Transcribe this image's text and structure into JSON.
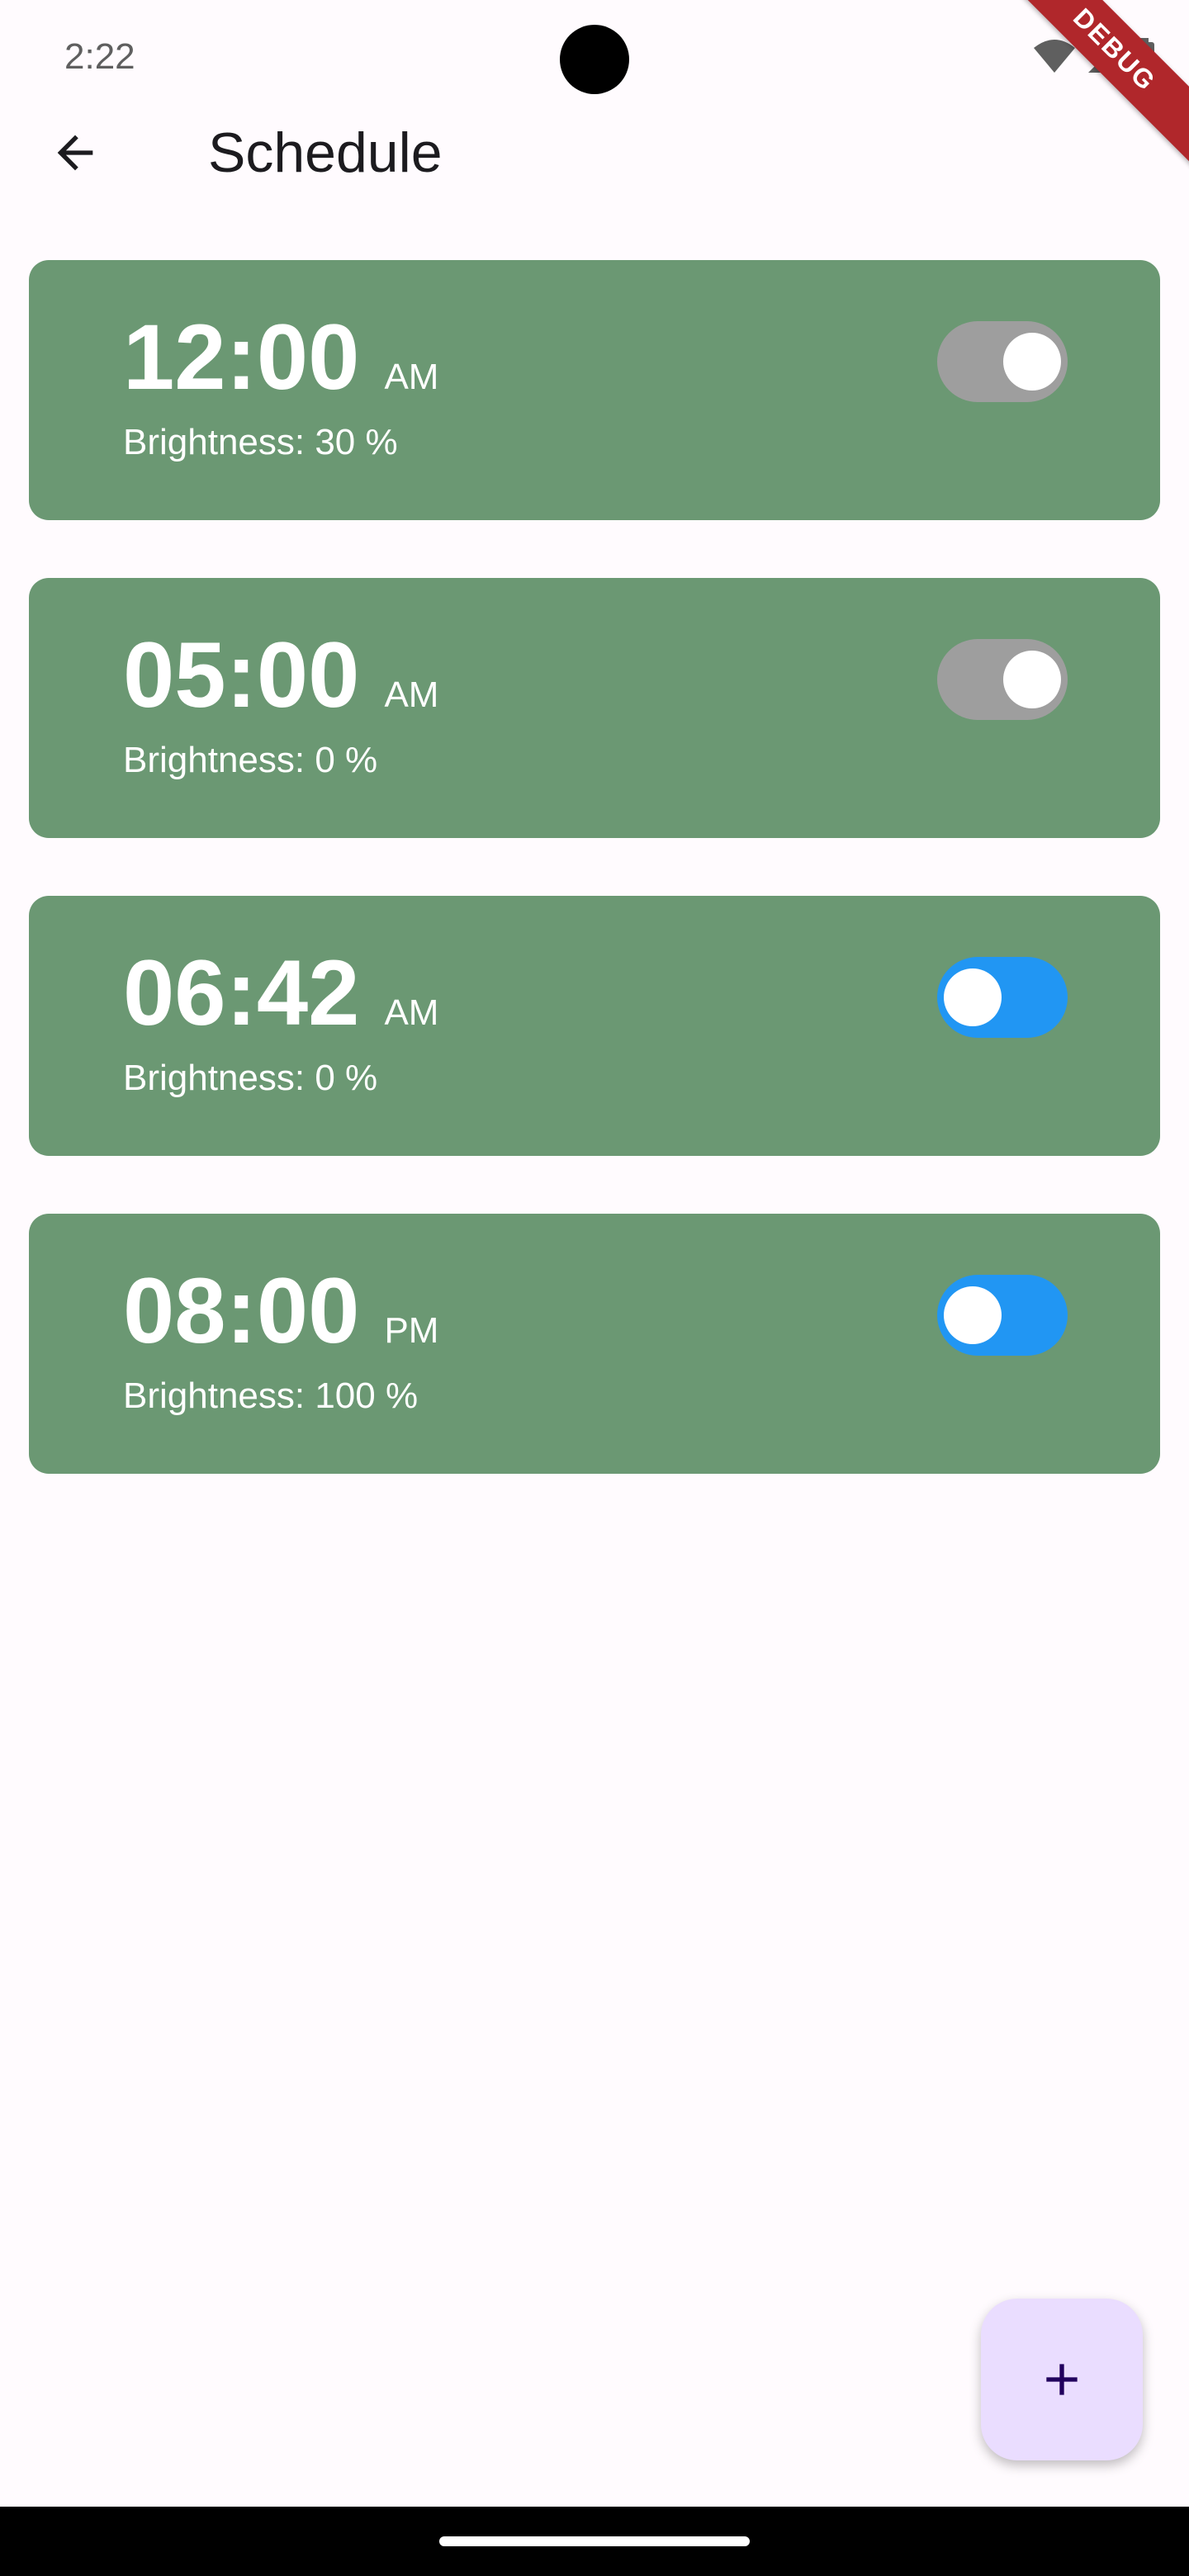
{
  "status_bar": {
    "time": "2:22",
    "icons": [
      "wifi-icon",
      "signal-icon",
      "battery-icon"
    ]
  },
  "debug_banner": {
    "label": "DEBUG",
    "color": "#b0272b"
  },
  "app_bar": {
    "title": "Schedule",
    "back_icon": "arrow-back-icon"
  },
  "colors": {
    "background": "#fffbfe",
    "card": "#6b9873",
    "toggle_on": "#2196f3",
    "toggle_off": "#9e9e9e",
    "fab": "#eaddff",
    "fab_icon": "#21005d"
  },
  "schedules": [
    {
      "time": "12:00",
      "period": "AM",
      "brightness": "Brightness: 30 %",
      "enabled": false
    },
    {
      "time": "05:00",
      "period": "AM",
      "brightness": "Brightness: 0 %",
      "enabled": false
    },
    {
      "time": "06:42",
      "period": "AM",
      "brightness": "Brightness: 0 %",
      "enabled": true
    },
    {
      "time": "08:00",
      "period": "PM",
      "brightness": "Brightness: 100 %",
      "enabled": true
    }
  ],
  "fab": {
    "icon": "add-icon"
  }
}
